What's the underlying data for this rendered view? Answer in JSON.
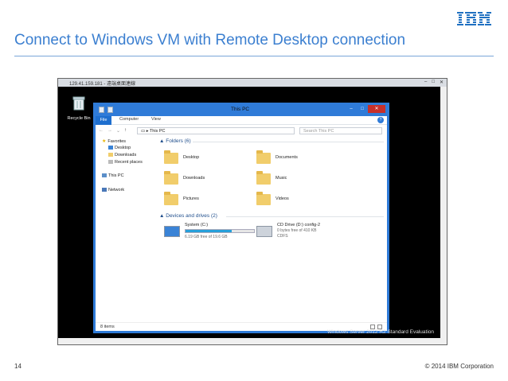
{
  "slide": {
    "title": "Connect to Windows VM with Remote Desktop connection",
    "logo": "IBM",
    "page_number": "14",
    "copyright": "© 2014 IBM Corporation"
  },
  "rdp_window": {
    "title": "129.41.159.181 - 遠端桌面連線",
    "desktop_watermark": "Windows Server 2012 R2 Standard Evaluation",
    "recycle_bin_label": "Recycle Bin"
  },
  "explorer": {
    "title": "This PC",
    "ribbon_tabs": [
      "File",
      "Computer",
      "View"
    ],
    "address": "This PC",
    "search_placeholder": "Search This PC",
    "sidebar": {
      "favorites": "Favorites",
      "favorites_items": [
        "Desktop",
        "Downloads",
        "Recent places"
      ],
      "this_pc": "This PC",
      "network": "Network"
    },
    "folders_header": "Folders (6)",
    "folders": [
      "Desktop",
      "Documents",
      "Downloads",
      "Music",
      "Pictures",
      "Videos"
    ],
    "drives_header": "Devices and drives (2)",
    "drives": [
      {
        "name": "System (C:)",
        "free_text": "6.19 GB free of 19.6 GB",
        "used_fraction": 0.68
      },
      {
        "name": "CD Drive (D:) config-2",
        "free_text": "0 bytes free of 410 KB",
        "fs": "CDFS"
      }
    ],
    "status_text": "8 items"
  },
  "colors": {
    "title_blue": "#3b7fd0",
    "window_blue": "#2f7bd8",
    "close_red": "#c7302b",
    "folder_yellow": "#f1cd6b",
    "drive_bar": "#26a0da"
  }
}
